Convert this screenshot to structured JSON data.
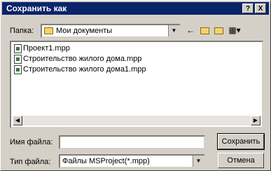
{
  "window": {
    "title": "Сохранить как"
  },
  "titlebar_buttons": {
    "help": "?",
    "close": "X"
  },
  "folder": {
    "label": "Папка:",
    "value": "Мои документы"
  },
  "files": [
    {
      "name": "Проект1.mpp"
    },
    {
      "name": "Строительство жилого дома.mpp"
    },
    {
      "name": "Строительство жилого дома1.mpp"
    }
  ],
  "filename": {
    "label": "Имя файла:",
    "value": ""
  },
  "filetype": {
    "label": "Тип файла:",
    "value": "Файлы MSProject(*.mpp)"
  },
  "buttons": {
    "save": "Сохранить",
    "cancel": "Отмена"
  },
  "icons": {
    "back": "back-arrow-icon",
    "up": "up-folder-icon",
    "new_folder": "new-folder-icon",
    "view": "view-menu-icon"
  }
}
